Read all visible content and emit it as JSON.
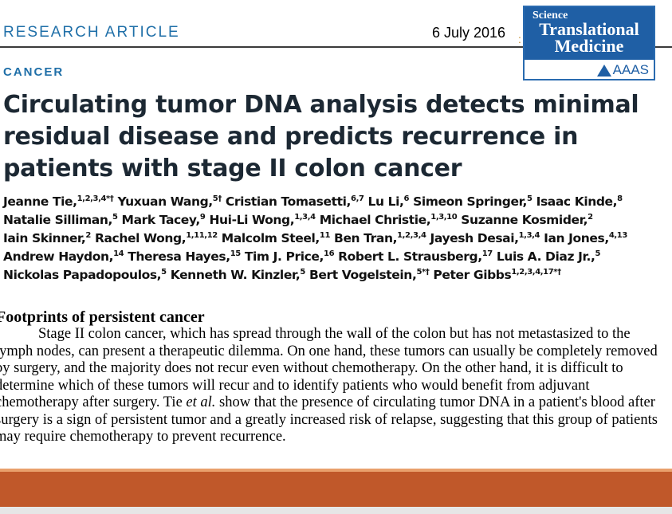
{
  "header": {
    "label": "RESEARCH ARTICLE",
    "date": "6 July 2016"
  },
  "logo": {
    "science": "Science",
    "line1": "Translational",
    "line2": "Medicine",
    "publisher": "AAAS"
  },
  "section": "CANCER",
  "title": "Circulating tumor DNA analysis detects minimal residual disease and predicts recurrence in patients with stage II colon cancer",
  "authors": [
    [
      [
        "Jeanne Tie,",
        "1,2,3,4",
        "*†"
      ],
      [
        " Yuxuan Wang,",
        "5†",
        ""
      ],
      [
        " Cristian Tomasetti,",
        "6,7",
        ""
      ],
      [
        " Lu Li,",
        "6",
        ""
      ],
      [
        " Simeon Springer,",
        "5",
        ""
      ],
      [
        " Isaac Kinde,",
        "8",
        ""
      ]
    ],
    [
      [
        "Natalie Silliman,",
        "5",
        ""
      ],
      [
        " Mark Tacey,",
        "9",
        ""
      ],
      [
        " Hui-Li Wong,",
        "1,3,4",
        ""
      ],
      [
        " Michael Christie,",
        "1,3,10",
        ""
      ],
      [
        " Suzanne Kosmider,",
        "2",
        ""
      ]
    ],
    [
      [
        "Iain Skinner,",
        "2",
        ""
      ],
      [
        " Rachel Wong,",
        "1,11,12",
        ""
      ],
      [
        " Malcolm Steel,",
        "11",
        ""
      ],
      [
        " Ben Tran,",
        "1,2,3,4",
        ""
      ],
      [
        " Jayesh Desai,",
        "1,3,4",
        ""
      ],
      [
        " Ian Jones,",
        "4,13",
        ""
      ]
    ],
    [
      [
        "Andrew Haydon,",
        "14",
        ""
      ],
      [
        " Theresa Hayes,",
        "15",
        ""
      ],
      [
        " Tim J. Price,",
        "16",
        ""
      ],
      [
        " Robert L. Strausberg,",
        "17",
        ""
      ],
      [
        " Luis A. Diaz Jr.,",
        "5",
        ""
      ]
    ],
    [
      [
        "Nickolas Papadopoulos,",
        "5",
        ""
      ],
      [
        " Kenneth W. Kinzler,",
        "5",
        ""
      ],
      [
        " Bert Vogelstein,",
        "5*†",
        ""
      ],
      [
        " Peter Gibbs",
        "1,2,3,4,17",
        "*†"
      ]
    ]
  ],
  "footprints": {
    "title": "Footprints of persistent cancer",
    "body_before": "Stage II colon cancer, which has spread through the wall of the colon but has not metastasized to the lymph nodes, can present a therapeutic dilemma. On one hand, these tumors can usually be completely removed by surgery, and the majority does not recur even without chemotherapy. On the other hand, it is difficult to determine which of these tumors will recur and to identify patients who would benefit from adjuvant chemotherapy after surgery. Tie ",
    "body_italic": "et al.",
    "body_after": " show that the presence of circulating tumor DNA in a patient's blood after surgery is a sign of persistent tumor and a greatly increased risk of relapse, suggesting that this group of patients may require chemotherapy to prevent recurrence."
  },
  "colors": {
    "accent_blue": "#1f6fa8",
    "logo_blue": "#1f5fa5",
    "footer_band": "#c0582a"
  }
}
